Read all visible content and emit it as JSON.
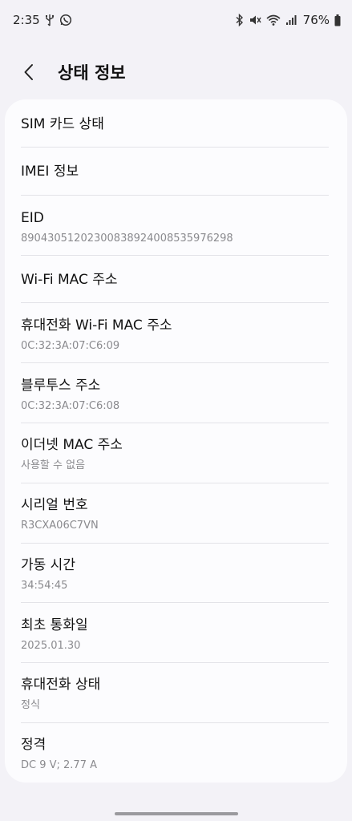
{
  "status_bar": {
    "time": "2:35",
    "battery": "76%",
    "icons": [
      "usb-icon",
      "whatsapp-icon",
      "bluetooth-icon",
      "mute-icon",
      "wifi-icon",
      "signal-icon",
      "battery-icon"
    ]
  },
  "header": {
    "title": "상태 정보",
    "back_icon": "back-arrow-icon"
  },
  "items": [
    {
      "title": "SIM 카드 상태"
    },
    {
      "title": "IMEI 정보"
    },
    {
      "title": "EID",
      "sub": "89043051202300838924008535976298"
    },
    {
      "title": "Wi-Fi MAC 주소"
    },
    {
      "title": "휴대전화 Wi-Fi MAC 주소",
      "sub": "0C:32:3A:07:C6:09"
    },
    {
      "title": "블루투스 주소",
      "sub": "0C:32:3A:07:C6:08"
    },
    {
      "title": "이더넷 MAC 주소",
      "sub": "사용할 수 없음"
    },
    {
      "title": "시리얼 번호",
      "sub": "R3CXA06C7VN"
    },
    {
      "title": "가동 시간",
      "sub": "34:54:45"
    },
    {
      "title": "최초 통화일",
      "sub": "2025.01.30"
    },
    {
      "title": "휴대전화 상태",
      "sub": "정식"
    },
    {
      "title": "정격",
      "sub": "DC 9 V; 2.77 A"
    }
  ]
}
